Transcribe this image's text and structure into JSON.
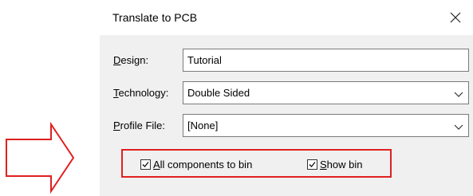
{
  "dialog": {
    "title": "Translate to PCB",
    "design": {
      "mnemonic": "D",
      "rest": "esign:",
      "value": "Tutorial"
    },
    "technology": {
      "mnemonic": "T",
      "rest": "echnology:",
      "value": "Double Sided"
    },
    "profile": {
      "mnemonic": "P",
      "rest": "rofile File:",
      "value": "[None]"
    },
    "all_components": {
      "mnemonic": "A",
      "rest": "ll components to bin",
      "checked": true
    },
    "show_bin": {
      "mnemonic": "S",
      "rest": "how bin",
      "checked": true
    }
  },
  "colors": {
    "highlight": "#e02020",
    "arrow": "#e02020"
  },
  "icons": {
    "close": "close-icon",
    "chevron": "chevron-down-icon",
    "arrow": "right-arrow-icon"
  }
}
